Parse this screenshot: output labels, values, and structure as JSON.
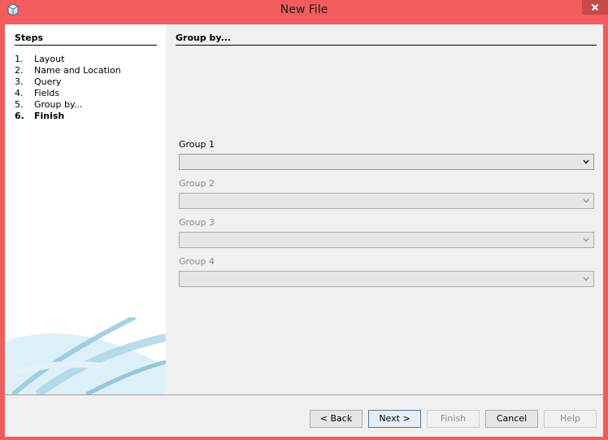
{
  "window": {
    "title": "New File",
    "app_icon": "cube-icon",
    "close_icon": "close-icon"
  },
  "steps": {
    "title": "Steps",
    "items": [
      {
        "num": "1.",
        "label": "Layout",
        "current": false
      },
      {
        "num": "2.",
        "label": "Name and Location",
        "current": false
      },
      {
        "num": "3.",
        "label": "Query",
        "current": false
      },
      {
        "num": "4.",
        "label": "Fields",
        "current": false
      },
      {
        "num": "5.",
        "label": "Group by...",
        "current": false
      },
      {
        "num": "6.",
        "label": "Finish",
        "current": true
      }
    ]
  },
  "panel": {
    "title": "Group by...",
    "groups": [
      {
        "label": "Group 1",
        "value": "",
        "enabled": true
      },
      {
        "label": "Group 2",
        "value": "",
        "enabled": false
      },
      {
        "label": "Group 3",
        "value": "",
        "enabled": false
      },
      {
        "label": "Group 4",
        "value": "",
        "enabled": false
      }
    ]
  },
  "buttons": {
    "back": "< Back",
    "next": "Next >",
    "finish": "Finish",
    "cancel": "Cancel",
    "help": "Help"
  },
  "colors": {
    "window_frame": "#f25c5c",
    "content_bg": "#f0f0f0",
    "swoosh": "#8fc6de"
  }
}
